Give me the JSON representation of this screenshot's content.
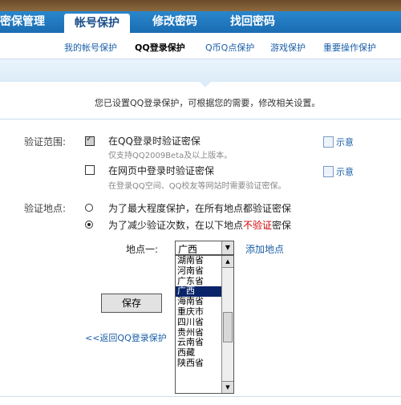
{
  "nav": {
    "tabs": [
      {
        "label": "密保管理"
      },
      {
        "label": "帐号保护"
      },
      {
        "label": "修改密码"
      },
      {
        "label": "找回密码"
      }
    ]
  },
  "subnav": {
    "items": [
      {
        "label": "我的帐号保护"
      },
      {
        "label": "QQ登录保护"
      },
      {
        "label": "Q币Q点保护"
      },
      {
        "label": "游戏保护"
      },
      {
        "label": "重要操作保护"
      }
    ]
  },
  "notice": "您已设置QQ登录保护，可根据您的需要，修改相关设置。",
  "scope": {
    "label": "验证范围:",
    "option1": {
      "text": "在QQ登录时验证密保",
      "sub": "仅支持QQ2009Beta及以上版本。",
      "example": "示意"
    },
    "option2": {
      "text": "在网页中登录时验证密保",
      "sub": "在登录QQ空间、QQ校友等网站时需要验证密保。",
      "example": "示意"
    }
  },
  "location": {
    "label": "验证地点:",
    "option1": "为了最大程度保护，在所有地点都验证密保",
    "option2_pre": "为了减少验证次数，在以下地点",
    "option2_red": "不验证",
    "option2_post": "密保",
    "place_label": "地点一:",
    "selected": "广西",
    "add_link": "添加地点",
    "provinces": [
      "湖南省",
      "河南省",
      "广东省",
      "广西",
      "海南省",
      "重庆市",
      "四川省",
      "贵州省",
      "云南省",
      "西藏",
      "陕西省"
    ]
  },
  "save_label": "保存",
  "back_link": "<<返回QQ登录保护"
}
